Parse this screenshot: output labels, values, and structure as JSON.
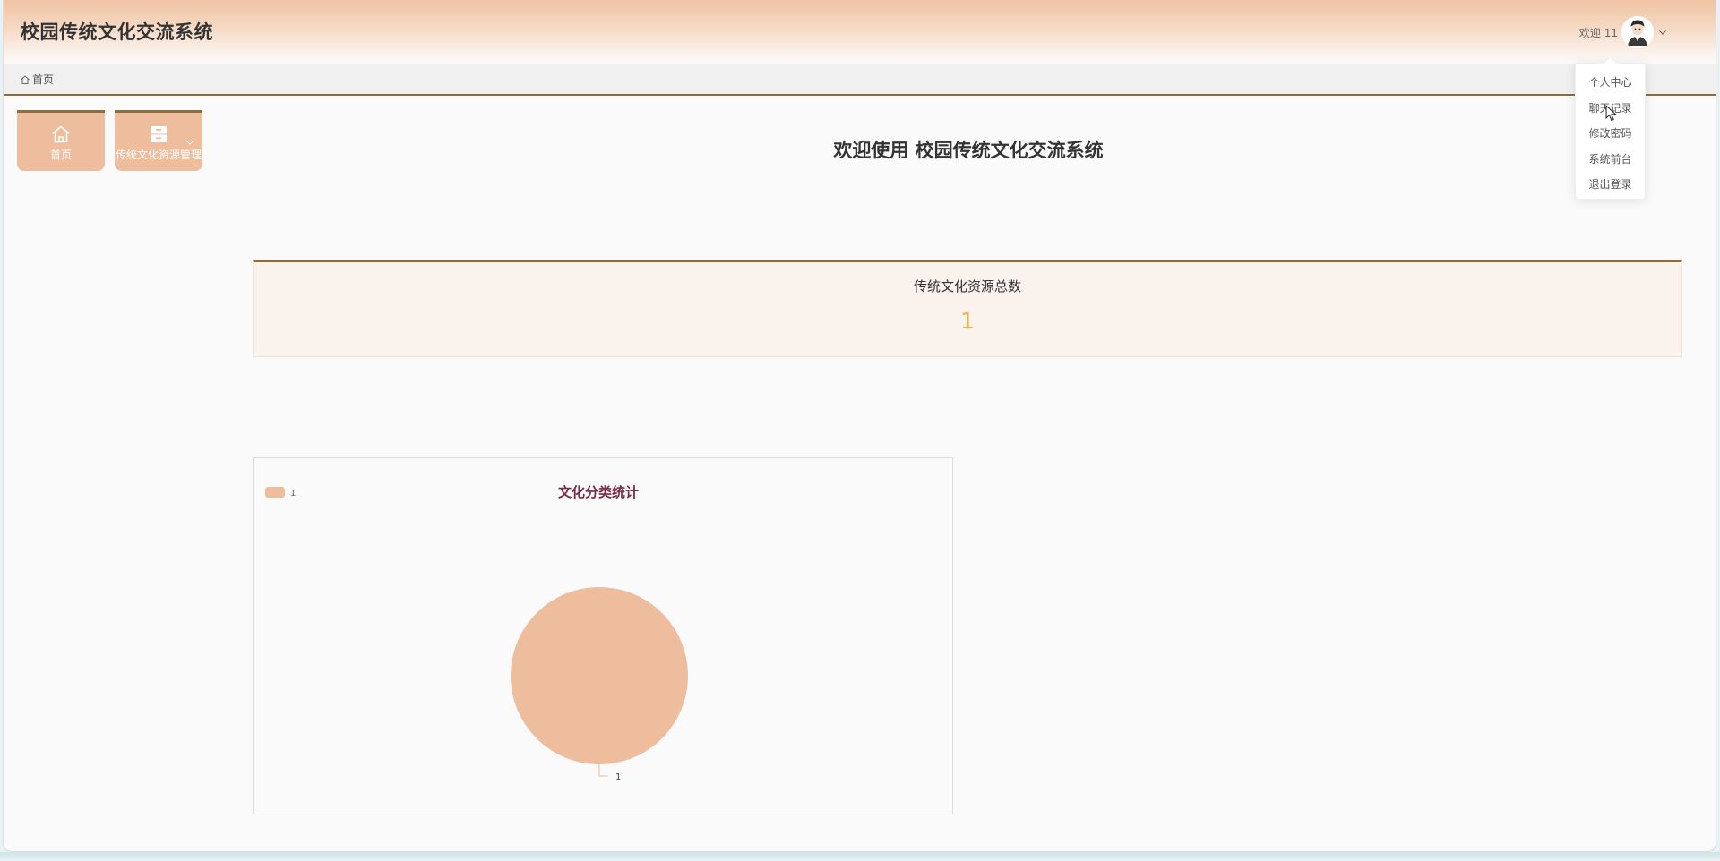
{
  "header": {
    "app_title": "校园传统文化交流系统",
    "welcome_label": "欢迎 11",
    "avatar_icon": "user-avatar",
    "dropdown_icon": "chevron-down-icon"
  },
  "breadcrumb": {
    "items": [
      "首页"
    ],
    "home_icon": "home-icon"
  },
  "user_menu": {
    "items": [
      "个人中心",
      "聊天记录",
      "修改密码",
      "系统前台",
      "退出登录"
    ]
  },
  "nav": {
    "tiles": [
      {
        "label": "首页",
        "icon": "home-icon"
      },
      {
        "label": "传统文化资源管理",
        "icon": "archive-icon"
      }
    ]
  },
  "main": {
    "welcome_heading": "欢迎使用 校园传统文化交流系统",
    "stats": {
      "label": "传统文化资源总数",
      "value": "1"
    }
  },
  "chart_data": {
    "type": "pie",
    "title": "文化分类统计",
    "categories": [
      "1"
    ],
    "values": [
      1
    ],
    "legend": "top-left",
    "slice_labels": [
      "1"
    ]
  },
  "colors": {
    "accent": "#8b6d3e",
    "tile": "#edbd9d",
    "stat_value": "#f0b24a",
    "chart_title": "#7a2a45",
    "pie": "#edbd9d",
    "header_gradient_top": "#f0c3a2"
  }
}
